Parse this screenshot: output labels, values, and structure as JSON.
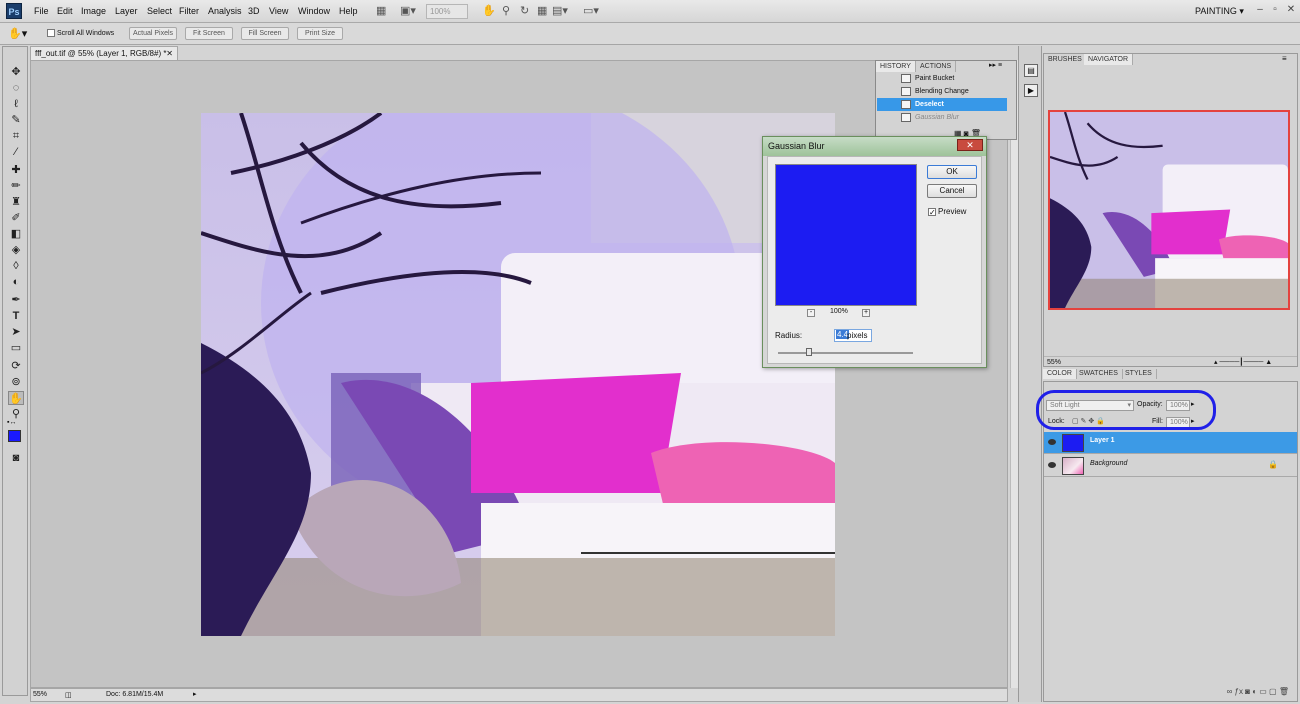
{
  "app": {
    "logo": "Ps",
    "workspace": "PAINTING"
  },
  "menu": [
    "File",
    "Edit",
    "Image",
    "Layer",
    "Select",
    "Filter",
    "Analysis",
    "3D",
    "View",
    "Window",
    "Help"
  ],
  "menubar": {
    "zoom_value": "100%"
  },
  "options": {
    "scroll_all_label": "Scroll All Windows",
    "buttons": [
      "Actual Pixels",
      "Fit Screen",
      "Fill Screen",
      "Print Size"
    ]
  },
  "document": {
    "tab_title": "fff_out.tif @ 55% (Layer 1, RGB/8#) *",
    "zoom": "55%",
    "doc_size": "Doc: 6.81M/15.4M"
  },
  "history_panel": {
    "tabs": [
      "HISTORY",
      "ACTIONS"
    ],
    "items": [
      {
        "label": "Paint Bucket",
        "state": "normal"
      },
      {
        "label": "Blending Change",
        "state": "normal"
      },
      {
        "label": "Deselect",
        "state": "selected"
      },
      {
        "label": "Gaussian Blur",
        "state": "dimmed"
      }
    ]
  },
  "dialog": {
    "title": "Gaussian Blur",
    "ok": "OK",
    "cancel": "Cancel",
    "preview_label": "Preview",
    "preview_checked": true,
    "zoom_out": "-",
    "zoom_in": "+",
    "zoom_level": "100%",
    "radius_label": "Radius:",
    "radius_value": "4.4",
    "radius_unit": "pixels",
    "preview_color": "#1c1cf2"
  },
  "navigator_panel": {
    "tabs": [
      "BRUSHES",
      "NAVIGATOR"
    ],
    "zoom": "55%"
  },
  "color_tabs": [
    "COLOR",
    "SWATCHES",
    "STYLES"
  ],
  "layers_panel": {
    "blend_mode": "Soft Light",
    "opacity_label": "Opacity:",
    "opacity": "100%",
    "lock_label": "Lock:",
    "fill_label": "Fill:",
    "fill": "100%",
    "layers": [
      {
        "name": "Layer 1",
        "selected": true
      },
      {
        "name": "Background",
        "selected": false,
        "locked": true
      }
    ]
  },
  "colors": {
    "foreground": "#1a1aff",
    "background": "#ffffff",
    "selection": "#3798e8",
    "annotation": "#2020e8"
  }
}
